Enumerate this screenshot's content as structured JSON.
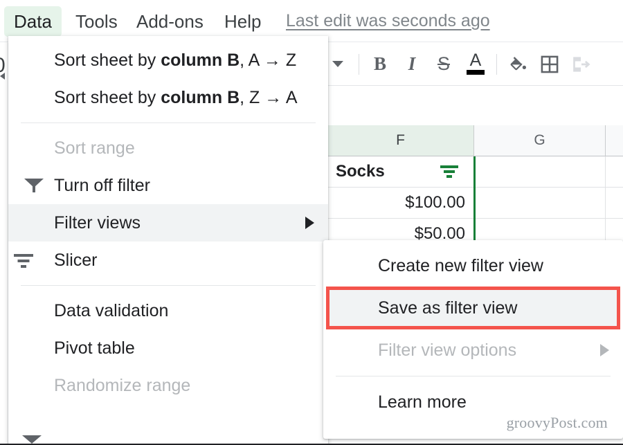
{
  "menubar": {
    "tabs": [
      {
        "label": "Data",
        "active": true
      },
      {
        "label": "Tools",
        "active": false
      },
      {
        "label": "Add-ons",
        "active": false
      },
      {
        "label": "Help",
        "active": false
      }
    ],
    "status_text": "Last edit was seconds ago",
    "active_tab_bg": "#e6f4ea"
  },
  "toolbar": {
    "items": [
      {
        "name": "font-size-dropdown",
        "glyph": "caret"
      },
      {
        "name": "bold",
        "glyph": "B"
      },
      {
        "name": "italic",
        "glyph": "I"
      },
      {
        "name": "strikethrough",
        "glyph": "S"
      },
      {
        "name": "text-color",
        "glyph": "A"
      },
      {
        "name": "fill-color",
        "glyph": "bucket"
      },
      {
        "name": "borders",
        "glyph": "grid"
      },
      {
        "name": "merge-cells",
        "glyph": "merge"
      }
    ]
  },
  "sheet": {
    "column_headers": [
      {
        "label": "F",
        "selected": true
      },
      {
        "label": "G",
        "selected": false
      },
      {
        "label": "",
        "selected": false
      }
    ],
    "selected_column": "F",
    "selection_color": "#188038",
    "rows": [
      {
        "e_stub": "",
        "f": "Socks",
        "f_bold": true,
        "f_filter": true,
        "g": "",
        "h": ""
      },
      {
        "e_stub": ")",
        "f": "$100.00",
        "f_bold": false,
        "f_filter": false,
        "g": "",
        "h": ""
      },
      {
        "e_stub": ")",
        "f": "$50.00",
        "f_bold": false,
        "f_filter": false,
        "g": "",
        "h": ""
      }
    ]
  },
  "data_menu": {
    "items": [
      {
        "id": "sort-az",
        "label_pre": "Sort sheet by ",
        "label_bold": "column B",
        "label_post": ", A → Z",
        "icon": "none",
        "disabled": false,
        "highlighted": false,
        "submenu": false
      },
      {
        "id": "sort-za",
        "label_pre": "Sort sheet by ",
        "label_bold": "column B",
        "label_post": ", Z → A",
        "icon": "none",
        "disabled": false,
        "highlighted": false,
        "submenu": false
      },
      {
        "id": "separator-1",
        "label": "",
        "type": "separator"
      },
      {
        "id": "sort-range",
        "label": "Sort range",
        "icon": "none",
        "disabled": true,
        "highlighted": false,
        "submenu": false
      },
      {
        "id": "turn-off-filter",
        "label": "Turn off filter",
        "icon": "funnel",
        "disabled": false,
        "highlighted": false,
        "submenu": false
      },
      {
        "id": "filter-views",
        "label": "Filter views",
        "icon": "none",
        "disabled": false,
        "highlighted": true,
        "submenu": true
      },
      {
        "id": "slicer",
        "label": "Slicer",
        "icon": "slicer",
        "disabled": false,
        "highlighted": false,
        "submenu": false
      },
      {
        "id": "separator-2",
        "label": "",
        "type": "separator"
      },
      {
        "id": "data-validation",
        "label": "Data validation",
        "icon": "none",
        "disabled": false,
        "highlighted": false,
        "submenu": false
      },
      {
        "id": "pivot-table",
        "label": "Pivot table",
        "icon": "none",
        "disabled": false,
        "highlighted": false,
        "submenu": false
      },
      {
        "id": "randomize-range",
        "label": "Randomize range",
        "icon": "none",
        "disabled": true,
        "highlighted": false,
        "submenu": false
      }
    ]
  },
  "filter_submenu": {
    "items": [
      {
        "id": "create-new-filter-view",
        "label": "Create new filter view",
        "disabled": false,
        "highlighted": false,
        "submenu": false
      },
      {
        "id": "save-as-filter-view",
        "label": "Save as filter view",
        "disabled": false,
        "highlighted": true,
        "submenu": false
      },
      {
        "id": "filter-view-options",
        "label": "Filter view options",
        "disabled": true,
        "highlighted": false,
        "submenu": true
      },
      {
        "id": "separator-3",
        "label": "",
        "type": "separator"
      },
      {
        "id": "learn-more",
        "label": "Learn more",
        "disabled": false,
        "highlighted": false,
        "submenu": false
      }
    ],
    "highlight_box_color": "#f4544c",
    "highlight_row_bg": "#f1f3f4"
  },
  "watermark": {
    "text": "groovyPost.com"
  }
}
